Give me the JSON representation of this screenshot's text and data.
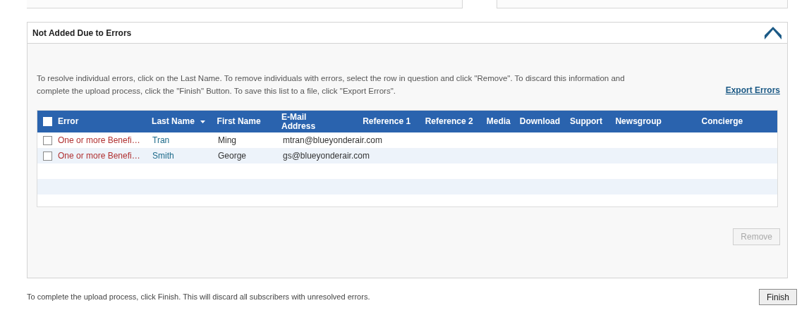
{
  "section": {
    "title": "Not Added Due to Errors",
    "expanded": true,
    "instructions": "To resolve individual errors, click on the Last Name. To remove individuals with errors, select the row in question and click \"Remove\". To discard this information and complete the upload process, click the \"Finish\" Button. To save this list to a file, click \"Export Errors\".",
    "export_link": "Export Errors",
    "table": {
      "select_all": {
        "checked": false
      },
      "columns": [
        {
          "label": "Error",
          "sorted": false
        },
        {
          "label": "Last Name",
          "sorted": true
        },
        {
          "label": "First Name",
          "sorted": false
        },
        {
          "label": "E-Mail Address",
          "sorted": false
        },
        {
          "label": "Reference 1",
          "sorted": false
        },
        {
          "label": "Reference 2",
          "sorted": false
        },
        {
          "label": "Media",
          "sorted": false
        },
        {
          "label": "Download",
          "sorted": false
        },
        {
          "label": "Support",
          "sorted": false
        },
        {
          "label": "Newsgroup",
          "sorted": false
        },
        {
          "label": "Concierge",
          "sorted": false
        }
      ],
      "rows": [
        {
          "checked": false,
          "error": "One or more Benefi…",
          "last_name": "Tran",
          "first_name": "Ming",
          "email": "mtran@blueyonderair.com"
        },
        {
          "checked": false,
          "error": "One or more Benefi…",
          "last_name": "Smith",
          "first_name": "George",
          "email": "gs@blueyonderair.com"
        }
      ]
    },
    "remove_button": {
      "label": "Remove",
      "disabled": true
    }
  },
  "footer": {
    "text": "To complete the upload process, click Finish. This will discard all subscribers with unresolved errors.",
    "finish_button": "Finish"
  }
}
